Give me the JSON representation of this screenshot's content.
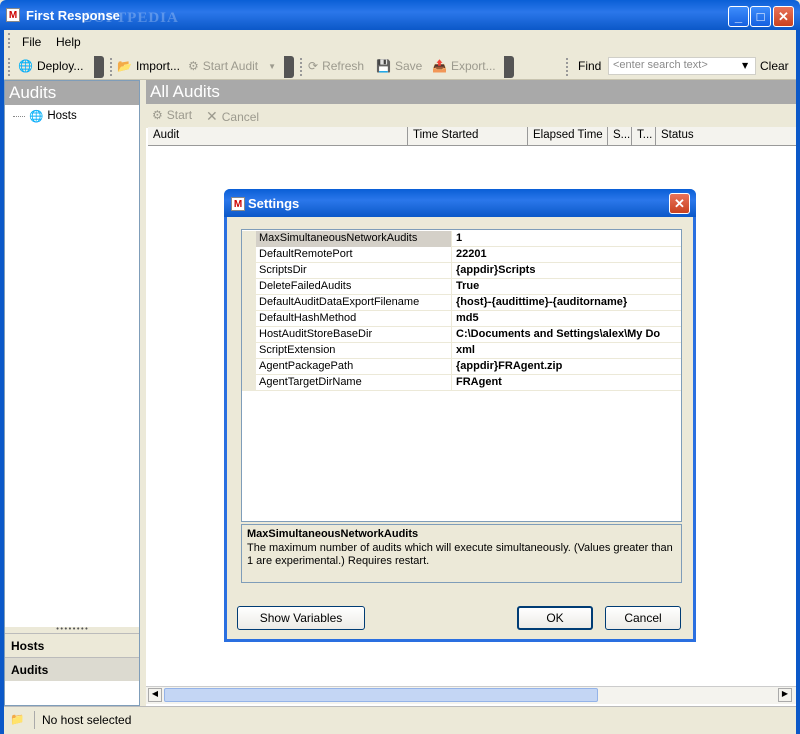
{
  "window": {
    "title": "First Response",
    "watermark": "SOFTPEDIA"
  },
  "menu": [
    {
      "label": "File"
    },
    {
      "label": "Help"
    }
  ],
  "toolbar": {
    "deploy": "Deploy...",
    "import": "Import...",
    "start_audit": "Start Audit",
    "refresh": "Refresh",
    "save": "Save",
    "export": "Export...",
    "find_label": "Find",
    "search_placeholder": "<enter search text>",
    "clear": "Clear"
  },
  "left_panel": {
    "title": "Audits",
    "tree": [
      {
        "label": "Hosts"
      }
    ],
    "bottom_buttons": [
      {
        "label": "Hosts"
      },
      {
        "label": "Audits"
      }
    ]
  },
  "right_panel": {
    "title": "All Audits",
    "start": "Start",
    "cancel": "Cancel",
    "columns": [
      "Audit",
      "Time Started",
      "Elapsed Time",
      "S...",
      "T...",
      "Status"
    ]
  },
  "status": {
    "text": "No host selected"
  },
  "dialog": {
    "title": "Settings",
    "properties": [
      {
        "name": "MaxSimultaneousNetworkAudits",
        "value": "1"
      },
      {
        "name": "DefaultRemotePort",
        "value": "22201"
      },
      {
        "name": "ScriptsDir",
        "value": "{appdir}Scripts"
      },
      {
        "name": "DeleteFailedAudits",
        "value": "True"
      },
      {
        "name": "DefaultAuditDataExportFilename",
        "value": "{host}-{audittime}-{auditorname}"
      },
      {
        "name": "DefaultHashMethod",
        "value": "md5"
      },
      {
        "name": "HostAuditStoreBaseDir",
        "value": "C:\\Documents and Settings\\alex\\My Do"
      },
      {
        "name": "ScriptExtension",
        "value": "xml"
      },
      {
        "name": "AgentPackagePath",
        "value": "{appdir}FRAgent.zip"
      },
      {
        "name": "AgentTargetDirName",
        "value": "FRAgent"
      }
    ],
    "description_title": "MaxSimultaneousNetworkAudits",
    "description_text": "The maximum number of audits which will execute simultaneously.  (Values greater than 1 are experimental.)  Requires restart.",
    "show_variables": "Show Variables",
    "ok": "OK",
    "cancel": "Cancel"
  }
}
